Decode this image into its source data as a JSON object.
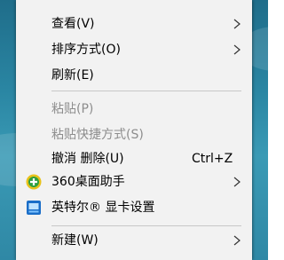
{
  "menu": {
    "items": [
      {
        "label": "查看(V)"
      },
      {
        "label": "排序方式(O)"
      },
      {
        "label": "刷新(E)"
      },
      {
        "label": "粘贴(P)"
      },
      {
        "label": "粘贴快捷方式(S)"
      },
      {
        "label": "撤消 删除(U)",
        "shortcut": "Ctrl+Z"
      },
      {
        "label": "360桌面助手"
      },
      {
        "label": "英特尔® 显卡设置"
      },
      {
        "label": "新建(W)"
      }
    ]
  },
  "colors": {
    "menu_background": "#f2f2f2",
    "disabled_text": "#8d8d8d",
    "separator": "#c8c8c8",
    "assistant_icon": "#e8c21a",
    "intel_icon": "#1a6ec8"
  },
  "icons": {
    "submenu": "chevron-right-icon",
    "assistant": "360-assistant-icon",
    "intel": "intel-graphics-icon"
  }
}
